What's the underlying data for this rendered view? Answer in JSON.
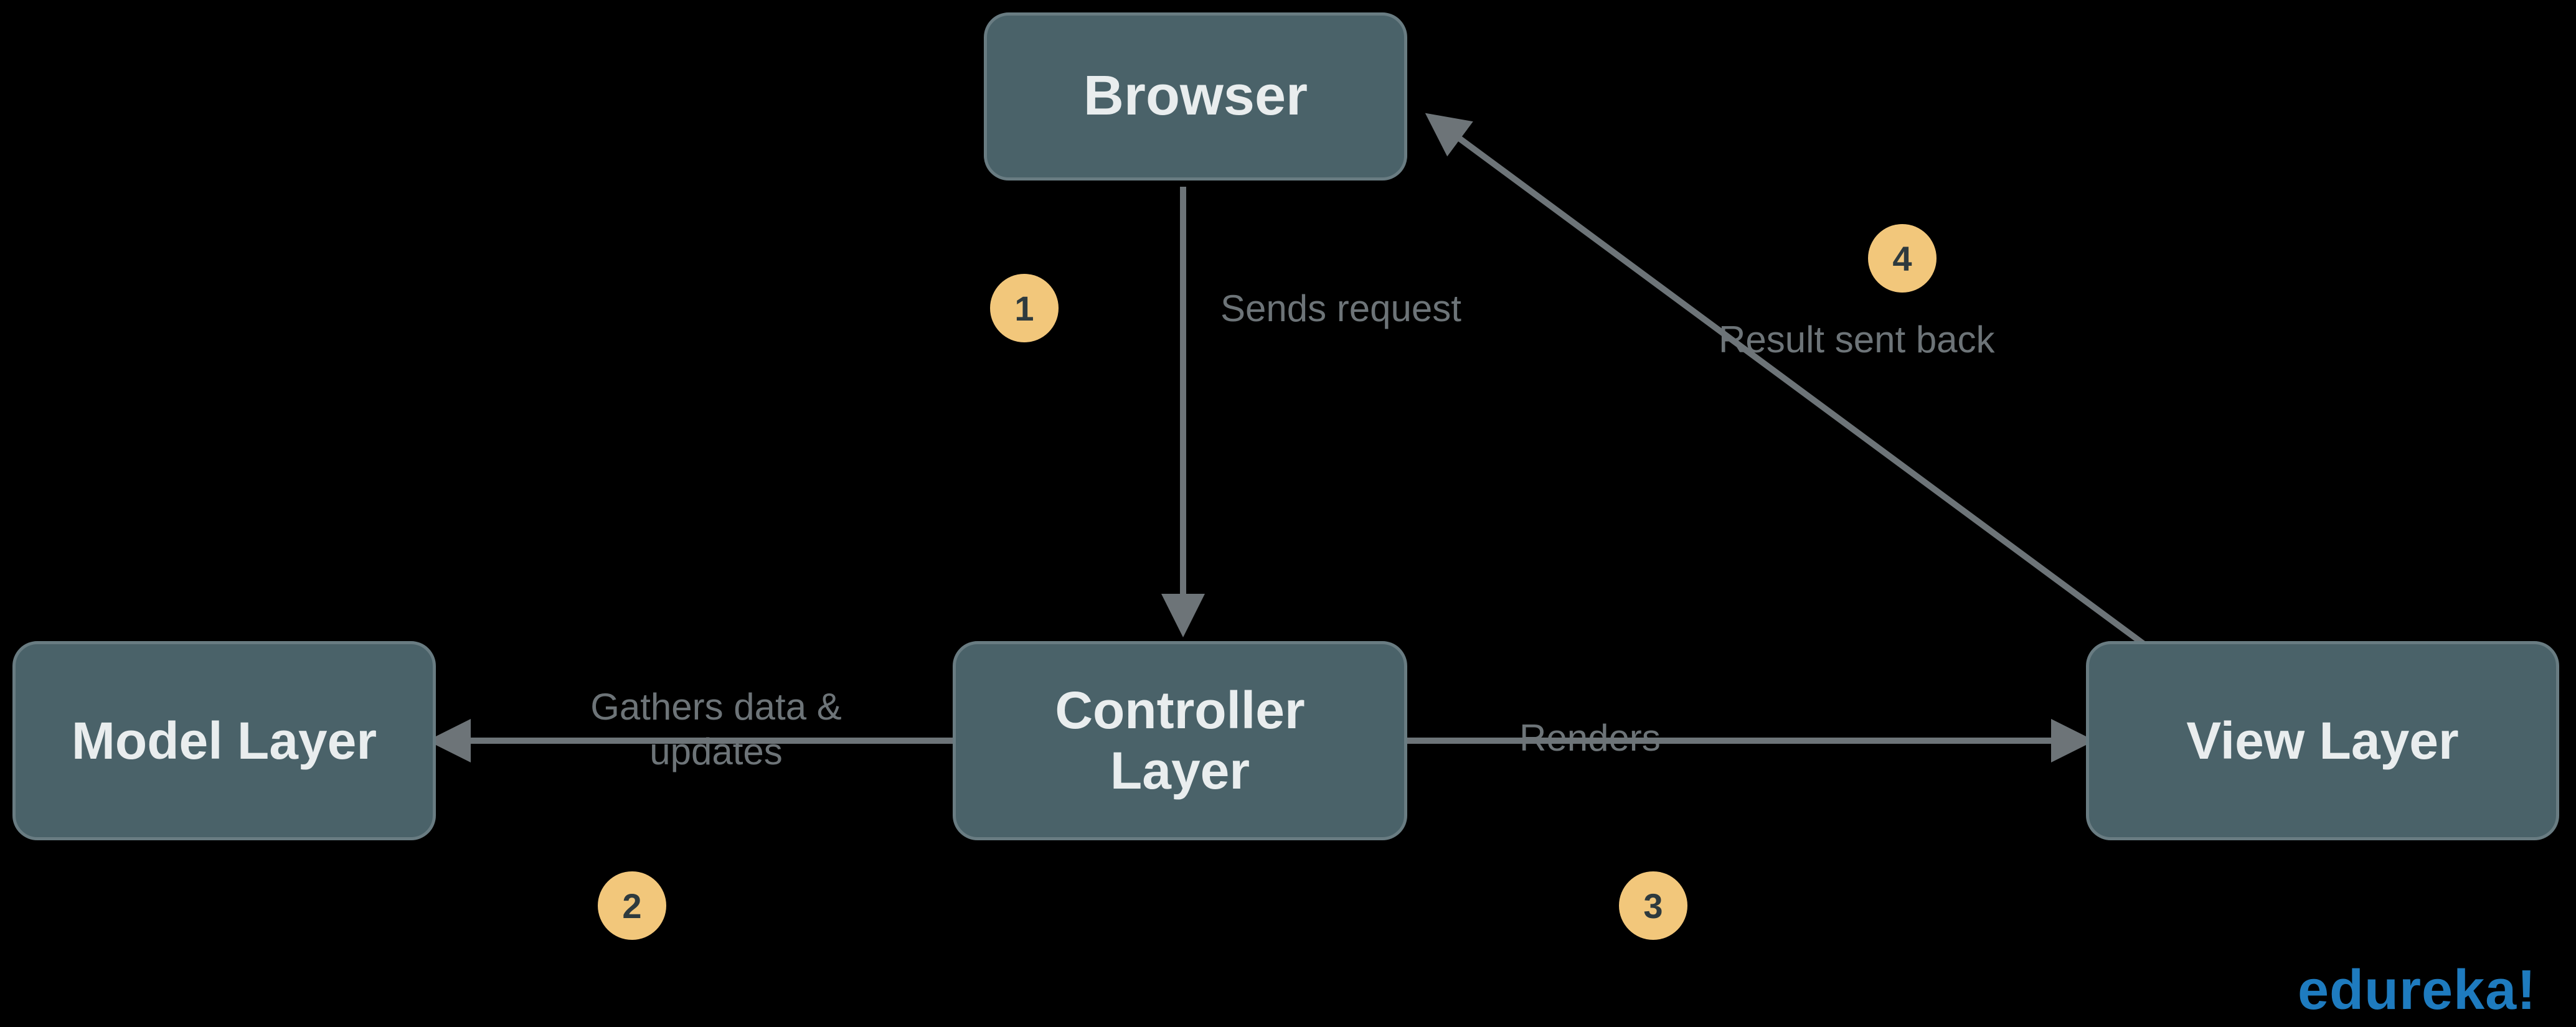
{
  "nodes": {
    "browser": {
      "label": "Browser"
    },
    "controller": {
      "label": "Controller Layer"
    },
    "model": {
      "label": "Model Layer"
    },
    "view": {
      "label": "View Layer"
    }
  },
  "edges": {
    "e1": {
      "num": "1",
      "label": "Sends request"
    },
    "e2": {
      "num": "2",
      "label": "Gathers data & updates"
    },
    "e3": {
      "num": "3",
      "label": "Renders"
    },
    "e4": {
      "num": "4",
      "label": "Result sent back"
    }
  },
  "brand": "edureka!",
  "colors": {
    "node_fill": "#4a6269",
    "node_border": "#697c82",
    "node_text": "#e9edee",
    "badge_fill": "#f2c77b",
    "badge_text": "#2e3a3e",
    "label_text": "#6d7478",
    "arrow": "#6d7478",
    "brand": "#1e7bbf",
    "background": "#000000"
  }
}
